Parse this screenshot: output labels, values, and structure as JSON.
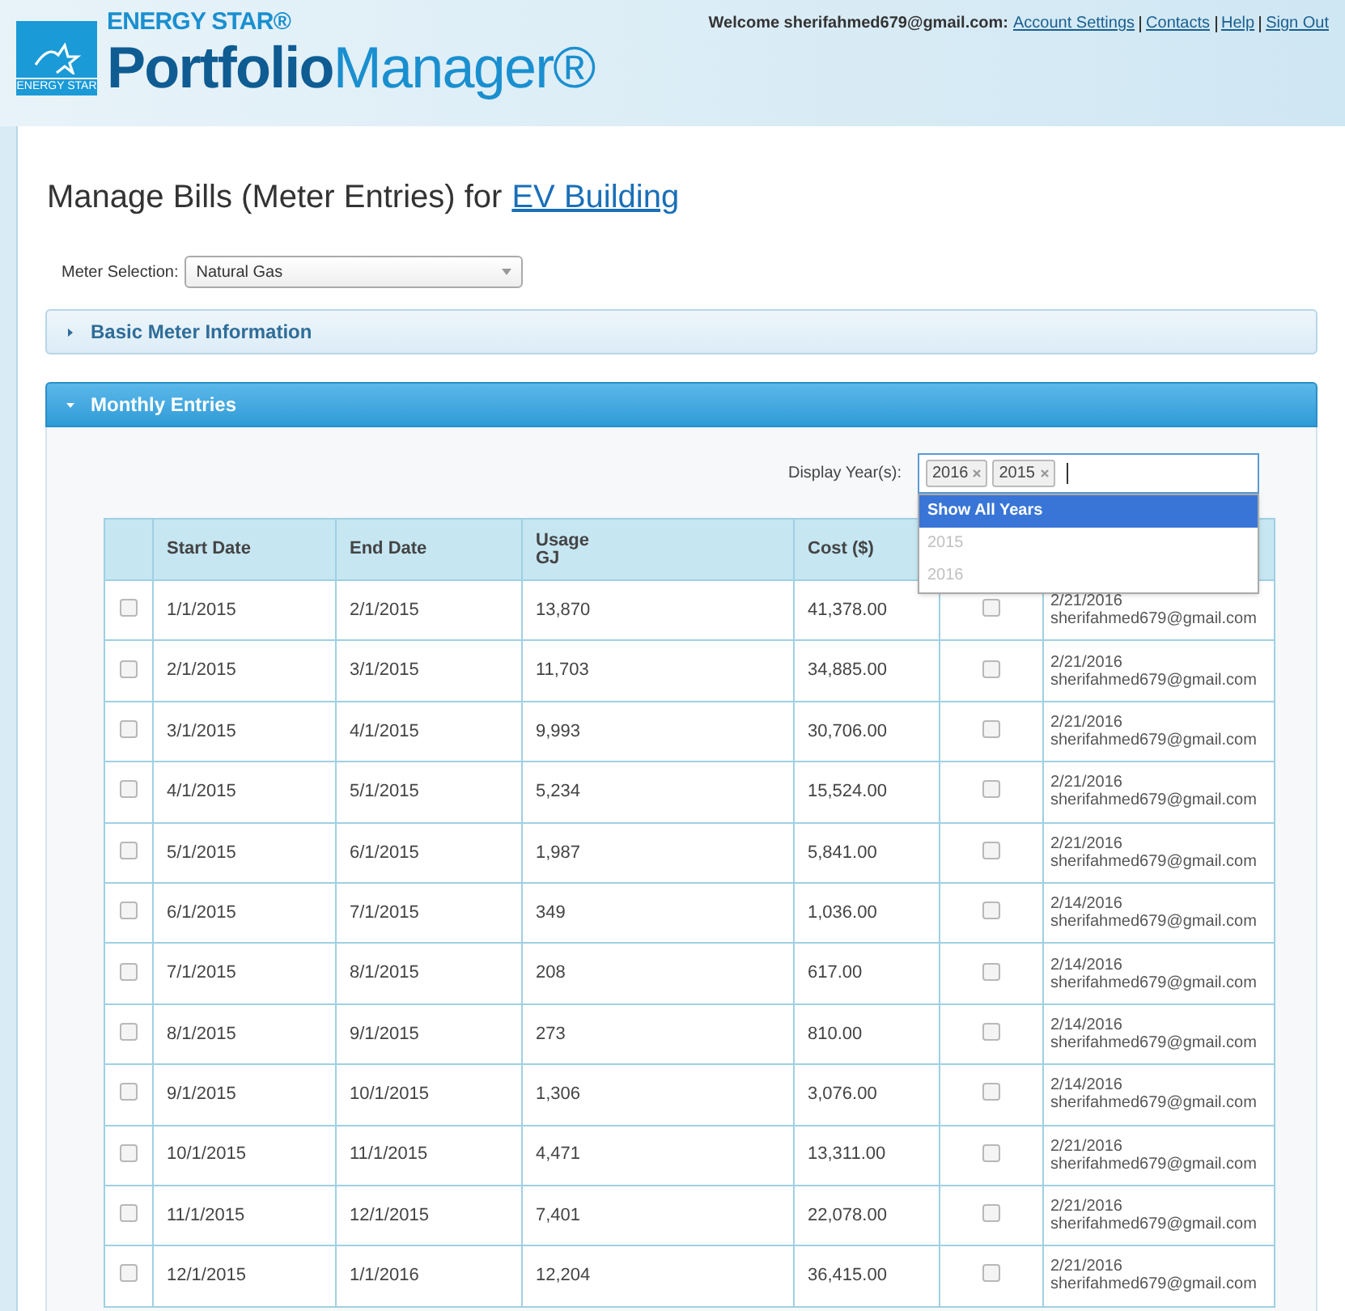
{
  "header": {
    "brand_small": "ENERGY STAR®",
    "brand_logo_text": "ENERGY STAR",
    "brand_bold": "Portfolio",
    "brand_light": "Manager®",
    "welcome": "Welcome sherifahmed679@gmail.com:",
    "links": [
      "Account Settings",
      "Contacts",
      "Help",
      "Sign Out"
    ]
  },
  "title": {
    "text": "Manage Bills (Meter Entries) for",
    "link": "EV Building"
  },
  "meter_selection": {
    "label": "Meter Selection:",
    "value": "Natural Gas"
  },
  "panels": [
    {
      "title": "Basic Meter Information",
      "expanded": false
    },
    {
      "title": "Monthly Entries",
      "expanded": true
    }
  ],
  "display_years": {
    "label": "Display Year(s):",
    "tags": [
      "2016",
      "2015"
    ],
    "options": [
      {
        "label": "Show All Years",
        "selected": true
      },
      {
        "label": "2015",
        "selected": false
      },
      {
        "label": "2016",
        "selected": false
      }
    ]
  },
  "table": {
    "columns": [
      "Start Date",
      "End Date",
      "Usage\nGJ",
      "Cost ($)"
    ],
    "rows": [
      {
        "start": "1/1/2015",
        "end": "2/1/2015",
        "usage": "13,870",
        "cost": "41,378.00",
        "checked": false,
        "estimated": false,
        "date": "2/21/2016",
        "user": "sherifahmed679@gmail.com"
      },
      {
        "start": "2/1/2015",
        "end": "3/1/2015",
        "usage": "11,703",
        "cost": "34,885.00",
        "checked": false,
        "estimated": false,
        "date": "2/21/2016",
        "user": "sherifahmed679@gmail.com"
      },
      {
        "start": "3/1/2015",
        "end": "4/1/2015",
        "usage": "9,993",
        "cost": "30,706.00",
        "checked": false,
        "estimated": false,
        "date": "2/21/2016",
        "user": "sherifahmed679@gmail.com"
      },
      {
        "start": "4/1/2015",
        "end": "5/1/2015",
        "usage": "5,234",
        "cost": "15,524.00",
        "checked": false,
        "estimated": false,
        "date": "2/21/2016",
        "user": "sherifahmed679@gmail.com"
      },
      {
        "start": "5/1/2015",
        "end": "6/1/2015",
        "usage": "1,987",
        "cost": "5,841.00",
        "checked": false,
        "estimated": false,
        "date": "2/21/2016",
        "user": "sherifahmed679@gmail.com"
      },
      {
        "start": "6/1/2015",
        "end": "7/1/2015",
        "usage": "349",
        "cost": "1,036.00",
        "checked": false,
        "estimated": false,
        "date": "2/14/2016",
        "user": "sherifahmed679@gmail.com"
      },
      {
        "start": "7/1/2015",
        "end": "8/1/2015",
        "usage": "208",
        "cost": "617.00",
        "checked": false,
        "estimated": false,
        "date": "2/14/2016",
        "user": "sherifahmed679@gmail.com"
      },
      {
        "start": "8/1/2015",
        "end": "9/1/2015",
        "usage": "273",
        "cost": "810.00",
        "checked": false,
        "estimated": false,
        "date": "2/14/2016",
        "user": "sherifahmed679@gmail.com"
      },
      {
        "start": "9/1/2015",
        "end": "10/1/2015",
        "usage": "1,306",
        "cost": "3,076.00",
        "checked": false,
        "estimated": false,
        "date": "2/14/2016",
        "user": "sherifahmed679@gmail.com"
      },
      {
        "start": "10/1/2015",
        "end": "11/1/2015",
        "usage": "4,471",
        "cost": "13,311.00",
        "checked": false,
        "estimated": false,
        "date": "2/21/2016",
        "user": "sherifahmed679@gmail.com"
      },
      {
        "start": "11/1/2015",
        "end": "12/1/2015",
        "usage": "7,401",
        "cost": "22,078.00",
        "checked": false,
        "estimated": false,
        "date": "2/21/2016",
        "user": "sherifahmed679@gmail.com"
      },
      {
        "start": "12/1/2015",
        "end": "1/1/2016",
        "usage": "12,204",
        "cost": "36,415.00",
        "checked": false,
        "estimated": false,
        "date": "2/21/2016",
        "user": "sherifahmed679@gmail.com"
      }
    ]
  }
}
